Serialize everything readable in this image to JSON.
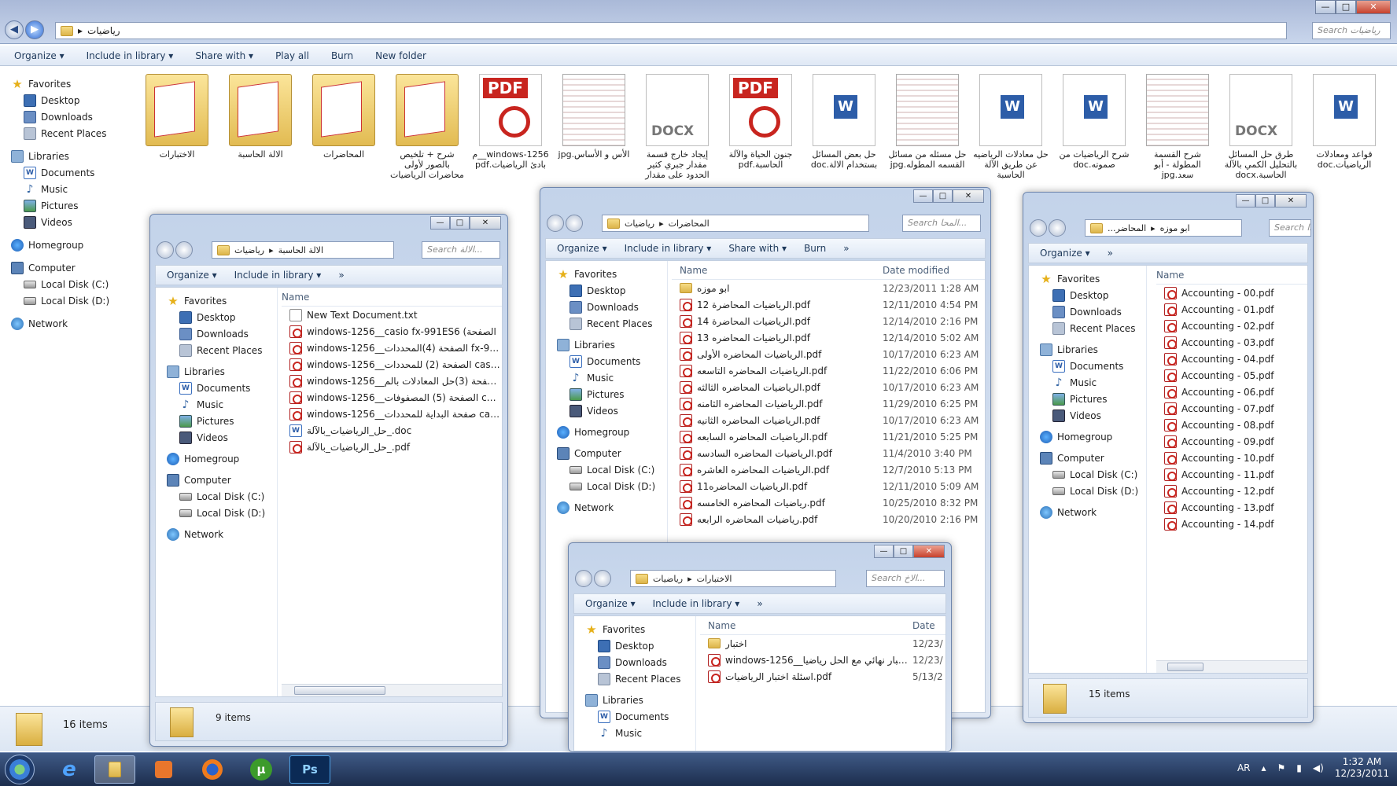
{
  "main": {
    "address": [
      "رياضيات"
    ],
    "search_placeholder": "Search رياضيات",
    "toolbar": [
      "Organize ▾",
      "Include in library ▾",
      "Share with ▾",
      "Play all",
      "Burn",
      "New folder"
    ],
    "sidebar": [
      {
        "label": "Favorites",
        "icon": "star",
        "top": true
      },
      {
        "label": "Desktop",
        "icon": "desktop"
      },
      {
        "label": "Downloads",
        "icon": "dl"
      },
      {
        "label": "Recent Places",
        "icon": "recent"
      },
      {
        "label": "Libraries",
        "icon": "lib",
        "top": true
      },
      {
        "label": "Documents",
        "icon": "doc"
      },
      {
        "label": "Music",
        "icon": "music"
      },
      {
        "label": "Pictures",
        "icon": "pic"
      },
      {
        "label": "Videos",
        "icon": "video"
      },
      {
        "label": "Homegroup",
        "icon": "home",
        "top": true
      },
      {
        "label": "Computer",
        "icon": "comp",
        "top": true
      },
      {
        "label": "Local Disk (C:)",
        "icon": "disk"
      },
      {
        "label": "Local Disk (D:)",
        "icon": "disk"
      },
      {
        "label": "Network",
        "icon": "net",
        "top": true
      }
    ],
    "files": [
      {
        "label": "الاختبارات",
        "kind": "folder"
      },
      {
        "label": "الالة الحاسبة",
        "kind": "folder"
      },
      {
        "label": "المحاضرات",
        "kind": "folder"
      },
      {
        "label": "شرح + تلخيص بالصور لأولى محاضرات الرياضيات",
        "kind": "folder"
      },
      {
        "label": "windows-1256__م بادئ الرياضيات.pdf",
        "kind": "pdfbig"
      },
      {
        "label": "الأس و الأساس.jpg",
        "kind": "img"
      },
      {
        "label": "إيجاد خارج قسمة مقدار جبري كثير الحدود على مقدار",
        "kind": "docx"
      },
      {
        "label": "جنون الحياة والآلة الحاسبة.pdf",
        "kind": "pdfbig"
      },
      {
        "label": "حل بعض المسائل بستخدام الالة.doc",
        "kind": "docbig"
      },
      {
        "label": "حل مسئله من مسائل القسمه المطوله.jpg",
        "kind": "img"
      },
      {
        "label": "حل معادلات الرياضيه عن طريق الآلة الحاسبة",
        "kind": "docbig"
      },
      {
        "label": "شرح الرياضيات من صموته.doc",
        "kind": "docbig"
      },
      {
        "label": "شرح القسمة المطولة - أبو سعد.jpg",
        "kind": "img"
      },
      {
        "label": "طرق حل المسائل بالتحليل الكمي بالآلة الحاسبة.docx",
        "kind": "docx"
      },
      {
        "label": "قواعد ومعادلات الرياضيات.doc",
        "kind": "docbig"
      }
    ],
    "status": "16 items"
  },
  "win_calc": {
    "address": [
      "رياضيات",
      "الالة الحاسبة"
    ],
    "search_placeholder": "Search الالة...",
    "toolbar": [
      "Organize ▾",
      "Include in library ▾",
      "»"
    ],
    "col_name": "Name",
    "files": [
      {
        "name": "New Text Document.txt",
        "kind": "txt"
      },
      {
        "name": "windows-1256__casio fx-991ES6 (الصفحة",
        "kind": "pdf"
      },
      {
        "name": "windows-1256__الصفحة (4)المحددات fx-991...",
        "kind": "pdf"
      },
      {
        "name": "windows-1256__الصفحة (2) للمحددات casio f...",
        "kind": "pdf"
      },
      {
        "name": "windows-1256__الصفحة (3)حل المعادلات بالم...",
        "kind": "pdf"
      },
      {
        "name": "windows-1256__الصفحة (5) المصفوفات cas...",
        "kind": "pdf"
      },
      {
        "name": "windows-1256__صفحة البداية للمحددات casio ...",
        "kind": "pdf"
      },
      {
        "name": "حل_الرياضيات_بالآلة_.doc",
        "kind": "doc"
      },
      {
        "name": "حل_الرياضيات_بالآلة_.pdf",
        "kind": "pdf"
      }
    ],
    "status": "9 items"
  },
  "win_lectures": {
    "address": [
      "رياضيات",
      "المحاضرات"
    ],
    "search_placeholder": "Search المحا...",
    "toolbar": [
      "Organize ▾",
      "Include in library ▾",
      "Share with ▾",
      "Burn",
      "»"
    ],
    "col_name": "Name",
    "col_date": "Date modified",
    "files": [
      {
        "name": "ابو موزه",
        "kind": "folder",
        "date": "12/23/2011 1:28 AM"
      },
      {
        "name": "الرياضيات المحاضرة 12.pdf",
        "kind": "pdf",
        "date": "12/11/2010 4:54 PM"
      },
      {
        "name": "الرياضيات المحاضرة 14.pdf",
        "kind": "pdf",
        "date": "12/14/2010 2:16 PM"
      },
      {
        "name": "الرياضيات المحاضره 13.pdf",
        "kind": "pdf",
        "date": "12/14/2010 5:02 AM"
      },
      {
        "name": "الرياضيات المحاضره الأولى.pdf",
        "kind": "pdf",
        "date": "10/17/2010 6:23 AM"
      },
      {
        "name": "الرياضيات المحاضره التاسعه.pdf",
        "kind": "pdf",
        "date": "11/22/2010 6:06 PM"
      },
      {
        "name": "الرياضيات المحاضره الثالثه.pdf",
        "kind": "pdf",
        "date": "10/17/2010 6:23 AM"
      },
      {
        "name": "الرياضيات المحاضره الثامنه.pdf",
        "kind": "pdf",
        "date": "11/29/2010 6:25 PM"
      },
      {
        "name": "الرياضيات المحاضره الثانيه.pdf",
        "kind": "pdf",
        "date": "10/17/2010 6:23 AM"
      },
      {
        "name": "الرياضيات المحاضره السابعه.pdf",
        "kind": "pdf",
        "date": "11/21/2010 5:25 PM"
      },
      {
        "name": "الرياضيات المحاضره السادسه.pdf",
        "kind": "pdf",
        "date": "11/4/2010 3:40 PM"
      },
      {
        "name": "الرياضيات المحاضره العاشره.pdf",
        "kind": "pdf",
        "date": "12/7/2010 5:13 PM"
      },
      {
        "name": "الرياضيات المحاضره11.pdf",
        "kind": "pdf",
        "date": "12/11/2010 5:09 AM"
      },
      {
        "name": "رياضيات المحاضره الخامسه.pdf",
        "kind": "pdf",
        "date": "10/25/2010 8:32 PM"
      },
      {
        "name": "رياضيات المحاضره الرابعه.pdf",
        "kind": "pdf",
        "date": "10/20/2010 2:16 PM"
      }
    ]
  },
  "win_abu": {
    "address": [
      "المحاضر...",
      "ابو موزه"
    ],
    "search_placeholder": "Search ا...",
    "toolbar": [
      "Organize ▾",
      "»"
    ],
    "col_name": "Name",
    "files": [
      "Accounting - 00.pdf",
      "Accounting - 01.pdf",
      "Accounting - 02.pdf",
      "Accounting - 03.pdf",
      "Accounting - 04.pdf",
      "Accounting - 05.pdf",
      "Accounting - 06.pdf",
      "Accounting - 07.pdf",
      "Accounting - 08.pdf",
      "Accounting - 09.pdf",
      "Accounting - 10.pdf",
      "Accounting - 11.pdf",
      "Accounting - 12.pdf",
      "Accounting - 13.pdf",
      "Accounting - 14.pdf"
    ],
    "status": "15 items"
  },
  "win_tests": {
    "address": [
      "رياضيات",
      "الاختبارات"
    ],
    "search_placeholder": "Search الاخ...",
    "toolbar": [
      "Organize ▾",
      "Include in library ▾",
      "»"
    ],
    "col_name": "Name",
    "col_date": "Date",
    "files": [
      {
        "name": "اختبار",
        "kind": "folder",
        "date": "12/23/"
      },
      {
        "name": "windows-1256__اختبار نهائي مع الحل رياضيا...",
        "kind": "pdf",
        "date": "12/23/"
      },
      {
        "name": "اسئلة اختبار الرياضيات.pdf",
        "kind": "pdf",
        "date": "5/13/2"
      }
    ]
  },
  "taskbar": {
    "lang": "AR",
    "time": "1:32 AM",
    "date": "12/23/2011",
    "ps_label": "Ps"
  }
}
